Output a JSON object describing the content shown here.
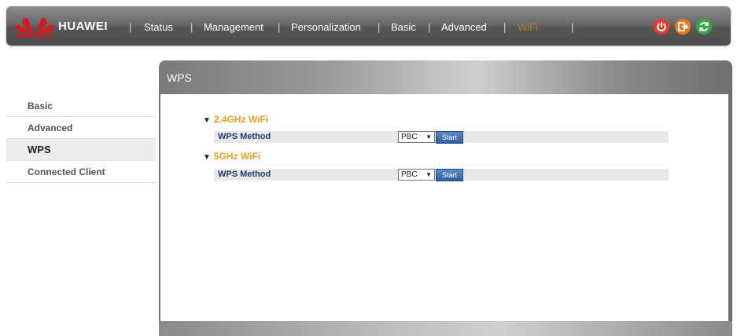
{
  "brand": {
    "name": "HUAWEI"
  },
  "nav": {
    "items": [
      {
        "label": "Status"
      },
      {
        "label": "Management"
      },
      {
        "label": "Personalization"
      },
      {
        "label": "Basic"
      },
      {
        "label": "Advanced"
      },
      {
        "label": "WiFi",
        "active": true
      }
    ]
  },
  "controls": {
    "power": {
      "icon": "power-icon",
      "color": "#e43c2c"
    },
    "logout": {
      "icon": "logout-icon",
      "color": "#f07820"
    },
    "refresh": {
      "icon": "refresh-icon",
      "color": "#3aa84a"
    }
  },
  "sidebar": {
    "items": [
      {
        "label": "Basic"
      },
      {
        "label": "Advanced"
      },
      {
        "label": "WPS",
        "active": true
      },
      {
        "label": "Connected Client"
      }
    ]
  },
  "panel": {
    "title": "WPS",
    "sections": [
      {
        "title": "2.4GHz WiFi",
        "row_label": "WPS Method",
        "method": "PBC",
        "start_label": "Start"
      },
      {
        "title": "5GHz WiFi",
        "row_label": "WPS Method",
        "method": "PBC",
        "start_label": "Start"
      }
    ]
  },
  "colors": {
    "accent": "#e8a020",
    "label": "#1f3a68"
  }
}
